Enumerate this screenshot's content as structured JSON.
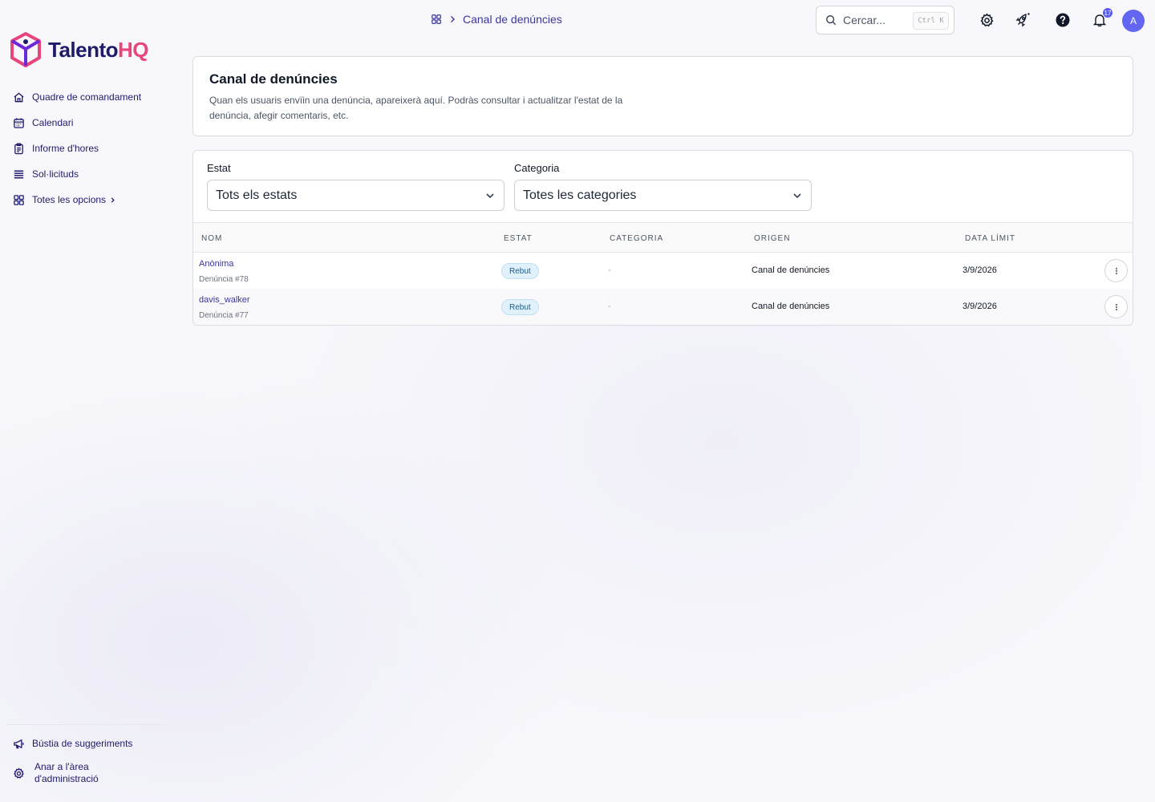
{
  "app": {
    "logo_part1": "Talento",
    "logo_part2": "HQ",
    "brand_navy": "#1e1b6b",
    "brand_pink": "#e8457a",
    "accent": "#6366f1"
  },
  "sidebar": {
    "items": [
      {
        "label": "Quadre de comandament",
        "icon": "home-icon"
      },
      {
        "label": "Calendari",
        "icon": "calendar-icon"
      },
      {
        "label": "Informe d'hores",
        "icon": "clipboard-icon"
      },
      {
        "label": "Sol·licituds",
        "icon": "list-icon"
      }
    ],
    "more": "Totes les opcions",
    "bottom": [
      {
        "label": "Bústia de suggeriments",
        "icon": "megaphone-icon"
      },
      {
        "label": "Anar a l'àrea d'administració",
        "icon": "gear-icon"
      }
    ]
  },
  "topbar": {
    "breadcrumb": "Canal de denúncies",
    "search_placeholder": "Cercar...",
    "shortcut": "Ctrl K",
    "notifications_count": "17",
    "avatar_initial": "A"
  },
  "header": {
    "title": "Canal de denúncies",
    "description": "Quan els usuaris envïin una denúncia, apareixerà aquí. Podràs consultar i actualitzar l'estat de la denúncia, afegir comentaris, etc."
  },
  "filters": {
    "status_label": "Estat",
    "status_value": "Tots els estats",
    "category_label": "Categoria",
    "category_value": "Totes les categories"
  },
  "table": {
    "columns": [
      "NOM",
      "ESTAT",
      "CATEGORIA",
      "ORIGEN",
      "DATA LÍMIT"
    ],
    "rows": [
      {
        "name": "Anònima",
        "ref": "Denúncia #78",
        "status": "Rebut",
        "category": "-",
        "origin": "Canal de denúncies",
        "deadline": "3/9/2026"
      },
      {
        "name": "davis_walker",
        "ref": "Denúncia #77",
        "status": "Rebut",
        "category": "-",
        "origin": "Canal de denúncies",
        "deadline": "3/9/2026"
      }
    ]
  }
}
